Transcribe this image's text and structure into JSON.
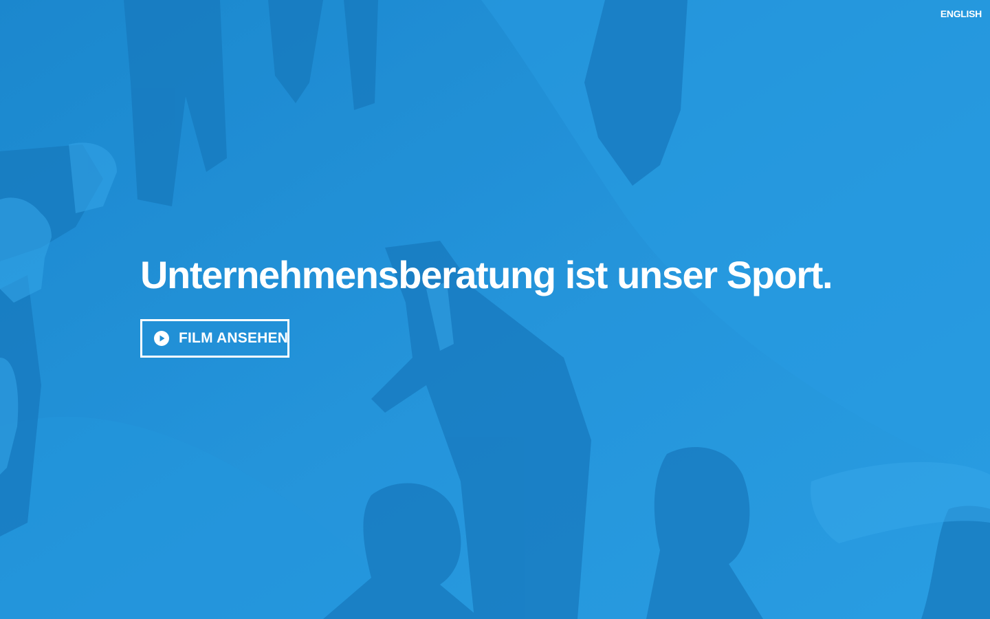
{
  "header": {
    "language_link": "ENGLISH"
  },
  "hero": {
    "headline": "Unternehmensberatung ist unser Sport.",
    "cta_label": "FILM ANSEHEN",
    "cta_icon": "play-circle-icon",
    "background_image": "runners-on-hill-photo"
  },
  "colors": {
    "overlay": "#1f8fd6",
    "text": "#ffffff"
  }
}
